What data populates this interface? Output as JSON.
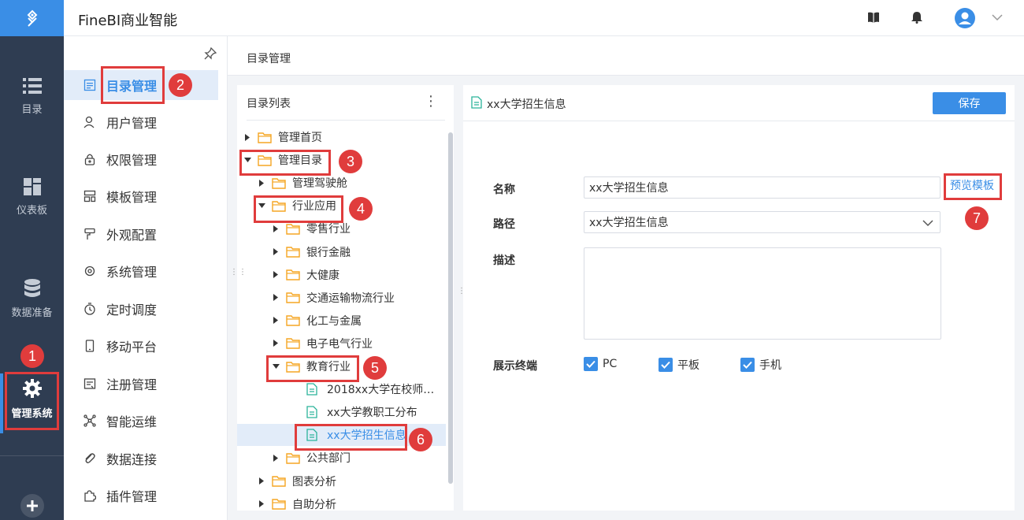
{
  "app": {
    "title": "FineBI商业智能"
  },
  "rail": {
    "items": [
      {
        "label": "目录"
      },
      {
        "label": "仪表板"
      },
      {
        "label": "数据准备"
      },
      {
        "label": "管理系统"
      }
    ]
  },
  "menu": {
    "items": [
      {
        "label": "目录管理",
        "icon": "list-doc-icon"
      },
      {
        "label": "用户管理",
        "icon": "user-icon"
      },
      {
        "label": "权限管理",
        "icon": "lock-icon"
      },
      {
        "label": "模板管理",
        "icon": "template-icon"
      },
      {
        "label": "外观配置",
        "icon": "brush-icon"
      },
      {
        "label": "系统管理",
        "icon": "gear-icon"
      },
      {
        "label": "定时调度",
        "icon": "timer-icon"
      },
      {
        "label": "移动平台",
        "icon": "mobile-icon"
      },
      {
        "label": "注册管理",
        "icon": "register-icon"
      },
      {
        "label": "智能运维",
        "icon": "network-icon"
      },
      {
        "label": "数据连接",
        "icon": "link-icon"
      },
      {
        "label": "插件管理",
        "icon": "plugin-icon"
      }
    ]
  },
  "breadcrumb": "目录管理",
  "tree": {
    "title": "目录列表",
    "more": "⋮",
    "nodes": [
      {
        "label": "管理首页",
        "type": "folder",
        "state": "collapsed"
      },
      {
        "label": "管理目录",
        "type": "folder",
        "state": "expanded"
      },
      {
        "label": "管理驾驶舱",
        "type": "folder",
        "state": "collapsed"
      },
      {
        "label": "行业应用",
        "type": "folder",
        "state": "expanded"
      },
      {
        "label": "零售行业",
        "type": "folder",
        "state": "collapsed"
      },
      {
        "label": "银行金融",
        "type": "folder",
        "state": "collapsed"
      },
      {
        "label": "大健康",
        "type": "folder",
        "state": "collapsed"
      },
      {
        "label": "交通运输物流行业",
        "type": "folder",
        "state": "collapsed"
      },
      {
        "label": "化工与金属",
        "type": "folder",
        "state": "collapsed"
      },
      {
        "label": "电子电气行业",
        "type": "folder",
        "state": "collapsed"
      },
      {
        "label": "教育行业",
        "type": "folder",
        "state": "expanded"
      },
      {
        "label": "2018xx大学在校师…",
        "type": "file"
      },
      {
        "label": "xx大学教职工分布",
        "type": "file"
      },
      {
        "label": "xx大学招生信息",
        "type": "file",
        "selected": true
      },
      {
        "label": "公共部门",
        "type": "folder",
        "state": "collapsed"
      },
      {
        "label": "图表分析",
        "type": "folder",
        "state": "collapsed"
      },
      {
        "label": "自助分析",
        "type": "folder",
        "state": "collapsed"
      }
    ]
  },
  "detail": {
    "title": "xx大学招生信息",
    "save_label": "保存",
    "name_label": "名称",
    "name_value": "xx大学招生信息",
    "path_label": "路径",
    "path_value": "xx大学招生信息",
    "preview_label": "预览模板",
    "desc_label": "描述",
    "terminal_label": "展示终端",
    "terminals": [
      {
        "label": "PC",
        "checked": true
      },
      {
        "label": "平板",
        "checked": true
      },
      {
        "label": "手机",
        "checked": true
      }
    ]
  },
  "annotations": [
    "1",
    "2",
    "3",
    "4",
    "5",
    "6",
    "7"
  ],
  "colors": {
    "accent": "#3a8ee6",
    "rail": "#2f3d52",
    "annotation": "#e03c3c",
    "folder": "#f5a623",
    "file": "#2bb39a"
  }
}
